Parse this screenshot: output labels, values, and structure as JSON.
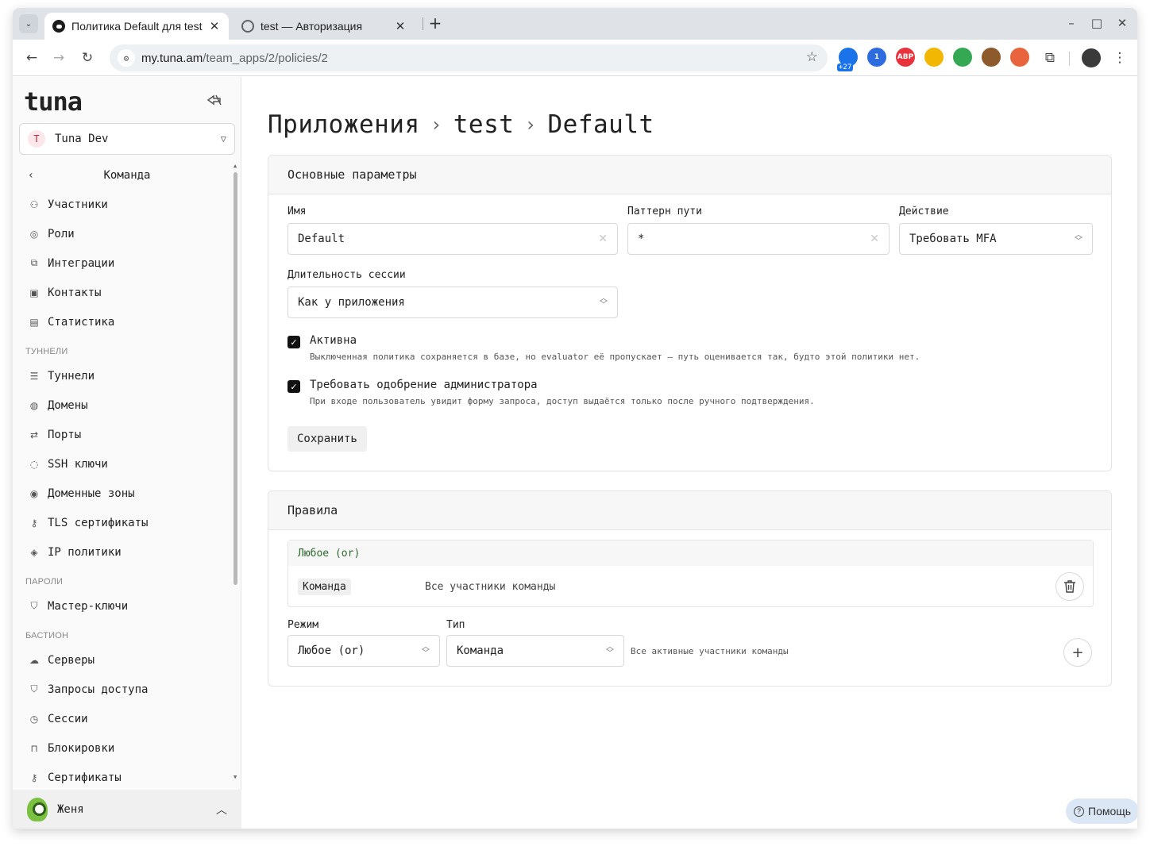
{
  "browser": {
    "tabs": [
      {
        "title": "Политика Default для test"
      },
      {
        "title": "test — Авторизация"
      }
    ],
    "url_host": "my.tuna.am",
    "url_path": "/team_apps/2/policies/2",
    "extensions": [
      {
        "name": "weather-ext",
        "color": "#1a73e8",
        "label": "",
        "badge": "+27"
      },
      {
        "name": "1password-ext",
        "color": "#2d6cdf",
        "label": "1",
        "badge": ""
      },
      {
        "name": "adblock-ext",
        "color": "#e8323c",
        "label": "ABP",
        "badge": ""
      },
      {
        "name": "color-ext-1",
        "color": "#f2b705",
        "label": "",
        "badge": ""
      },
      {
        "name": "color-ext-2",
        "color": "#34a853",
        "label": "",
        "badge": ""
      },
      {
        "name": "cookie-ext",
        "color": "#8d5a2b",
        "label": "",
        "badge": ""
      },
      {
        "name": "asterisk-ext",
        "color": "#e8643c",
        "label": "",
        "badge": ""
      }
    ]
  },
  "sidebar": {
    "logo": "tuna",
    "team": {
      "initial": "T",
      "name": "Tuna Dev"
    },
    "back_label": "Команда",
    "groups": [
      {
        "title": "",
        "items": [
          {
            "label": "Участники",
            "icon": "users-icon",
            "glyph": "⚇"
          },
          {
            "label": "Роли",
            "icon": "role-icon",
            "glyph": "◎"
          },
          {
            "label": "Интеграции",
            "icon": "integrations-icon",
            "glyph": "⧉"
          },
          {
            "label": "Контакты",
            "icon": "contacts-icon",
            "glyph": "▣"
          },
          {
            "label": "Статистика",
            "icon": "statistics-icon",
            "glyph": "▤"
          }
        ]
      },
      {
        "title": "ТУННЕЛИ",
        "items": [
          {
            "label": "Туннели",
            "icon": "tunnels-icon",
            "glyph": "☰"
          },
          {
            "label": "Домены",
            "icon": "globe-icon",
            "glyph": "◍"
          },
          {
            "label": "Порты",
            "icon": "ports-icon",
            "glyph": "⇄"
          },
          {
            "label": "SSH ключи",
            "icon": "fingerprint-icon",
            "glyph": "◌"
          },
          {
            "label": "Доменные зоны",
            "icon": "location-icon",
            "glyph": "◉"
          },
          {
            "label": "TLS сертификаты",
            "icon": "key-icon",
            "glyph": "⚷"
          },
          {
            "label": "IP политики",
            "icon": "network-icon",
            "glyph": "◈"
          }
        ]
      },
      {
        "title": "ПАРОЛИ",
        "items": [
          {
            "label": "Мастер-ключи",
            "icon": "shield-check-icon",
            "glyph": "⛉"
          }
        ]
      },
      {
        "title": "БАСТИОН",
        "items": [
          {
            "label": "Серверы",
            "icon": "cloud-icon",
            "glyph": "☁"
          },
          {
            "label": "Запросы доступа",
            "icon": "shield-icon",
            "glyph": "⛉"
          },
          {
            "label": "Сессии",
            "icon": "clock-icon",
            "glyph": "◷"
          },
          {
            "label": "Блокировки",
            "icon": "lock-icon",
            "glyph": "⊓"
          },
          {
            "label": "Сертификаты",
            "icon": "key-icon",
            "glyph": "⚷"
          }
        ]
      }
    ],
    "user": {
      "name": "Женя"
    }
  },
  "main": {
    "breadcrumb": [
      "Приложения",
      "test",
      "Default"
    ],
    "params_card": {
      "title": "Основные параметры",
      "name_label": "Имя",
      "name_value": "Default",
      "path_label": "Паттерн пути",
      "path_value": "*",
      "action_label": "Действие",
      "action_value": "Требовать MFA",
      "session_label": "Длительность сессии",
      "session_value": "Как у приложения",
      "active_title": "Активна",
      "active_desc": "Выключенная политика сохраняется в базе, но evaluator её пропускает — путь оценивается так, будто этой политики нет.",
      "active_checked": true,
      "approval_title": "Требовать одобрение администратора",
      "approval_desc": "При входе пользователь увидит форму запроса, доступ выдаётся только после ручного подтверждения.",
      "approval_checked": true,
      "save_label": "Сохранить"
    },
    "rules_card": {
      "title": "Правила",
      "group_header": "Любое (or)",
      "rule_tag": "Команда",
      "rule_desc": "Все участники команды",
      "mode_label": "Режим",
      "mode_value": "Любое (or)",
      "type_label": "Тип",
      "type_value": "Команда",
      "type_hint": "Все активные участники команды"
    },
    "help_label": "Помощь"
  }
}
